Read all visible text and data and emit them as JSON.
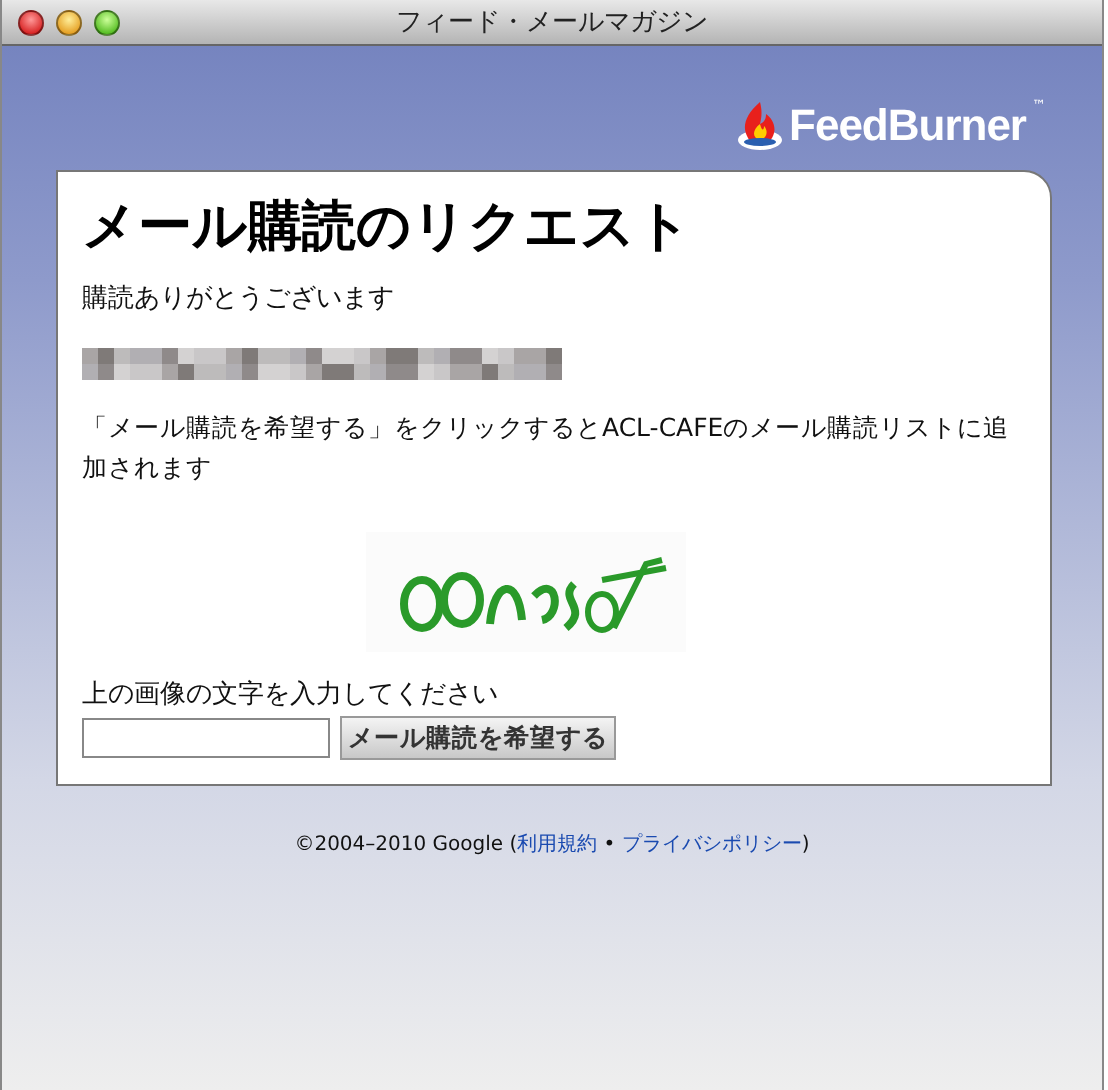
{
  "window": {
    "title": "フィード・メールマガジン"
  },
  "logo": {
    "name": "FeedBurner",
    "mark": "™"
  },
  "card": {
    "heading": "メール購読のリクエスト",
    "thanks": "購読ありがとうございます",
    "instructions": "「メール購読を希望する」をクリックするとACL-CAFEのメール購読リストに追加されます",
    "prompt": "上の画像の文字を入力してください",
    "button": "メール購読を希望する"
  },
  "footer": {
    "copyright": "©2004–2010 Google (",
    "links": [
      "利用規約",
      "プライバシポリシー"
    ],
    "separator": " • ",
    "close": ")"
  }
}
